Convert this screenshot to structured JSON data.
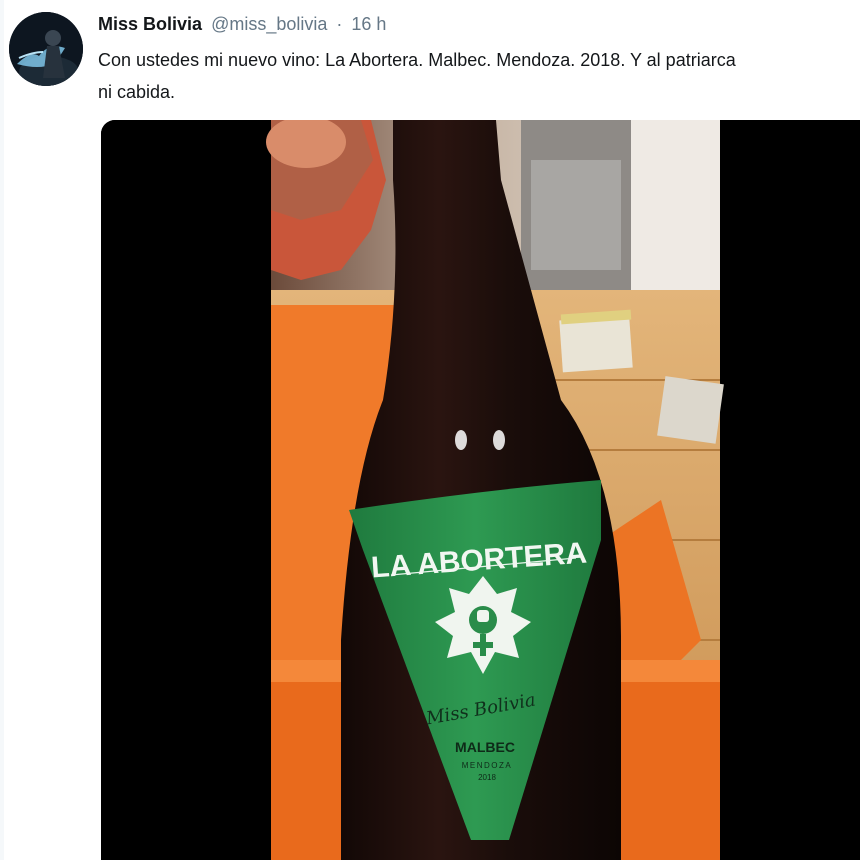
{
  "tweet": {
    "author": {
      "display_name": "Miss Bolivia",
      "username": "@miss_bolivia"
    },
    "separator": "·",
    "timestamp": "16 h",
    "text_lines": [
      "Con ustedes mi nuevo vino: La Abortera. Malbec. Mendoza. 2018. Y al patriarca",
      "ni cabida."
    ]
  },
  "media": {
    "label": {
      "brand": "LA ABORTERA",
      "signature": "Miss Bolivia",
      "variety": "MALBEC",
      "region": "MENDOZA",
      "vintage": "2018"
    },
    "colors": {
      "label_green": "#2a8c4a",
      "bottle": "#1a0d0a",
      "table_orange": "#f07a2a",
      "wood": "#d9a867"
    }
  }
}
